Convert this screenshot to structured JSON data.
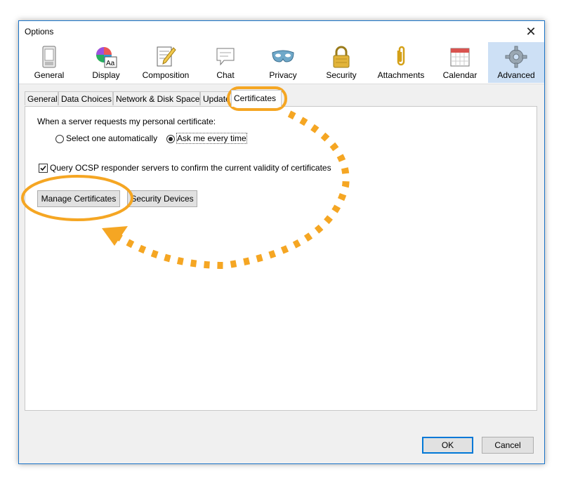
{
  "window": {
    "title": "Options",
    "close_glyph": "✕"
  },
  "toolbar": {
    "items": [
      {
        "label": "General",
        "icon": "general-icon"
      },
      {
        "label": "Display",
        "icon": "display-icon"
      },
      {
        "label": "Composition",
        "icon": "composition-icon"
      },
      {
        "label": "Chat",
        "icon": "chat-icon"
      },
      {
        "label": "Privacy",
        "icon": "privacy-icon"
      },
      {
        "label": "Security",
        "icon": "security-icon"
      },
      {
        "label": "Attachments",
        "icon": "attachments-icon"
      },
      {
        "label": "Calendar",
        "icon": "calendar-icon"
      },
      {
        "label": "Advanced",
        "icon": "advanced-icon",
        "selected": true
      }
    ]
  },
  "tabs": [
    {
      "label": "General"
    },
    {
      "label": "Data Choices"
    },
    {
      "label": "Network & Disk Space"
    },
    {
      "label": "Update"
    },
    {
      "label": "Certificates",
      "active": true
    }
  ],
  "certificates": {
    "prompt": "When a server requests my personal certificate:",
    "radio_auto": {
      "label": "Select one automatically",
      "checked": false
    },
    "radio_ask": {
      "label": "Ask me every time",
      "checked": true
    },
    "ocsp": {
      "label": "Query OCSP responder servers to confirm the current validity of certificates",
      "checked": true
    },
    "manage_button": "Manage Certificates",
    "devices_button": "Security Devices"
  },
  "footer": {
    "ok": "OK",
    "cancel": "Cancel"
  },
  "colors": {
    "highlight": "#f5a623",
    "accent": "#0078d7",
    "selected_bg": "#cde0f5"
  }
}
